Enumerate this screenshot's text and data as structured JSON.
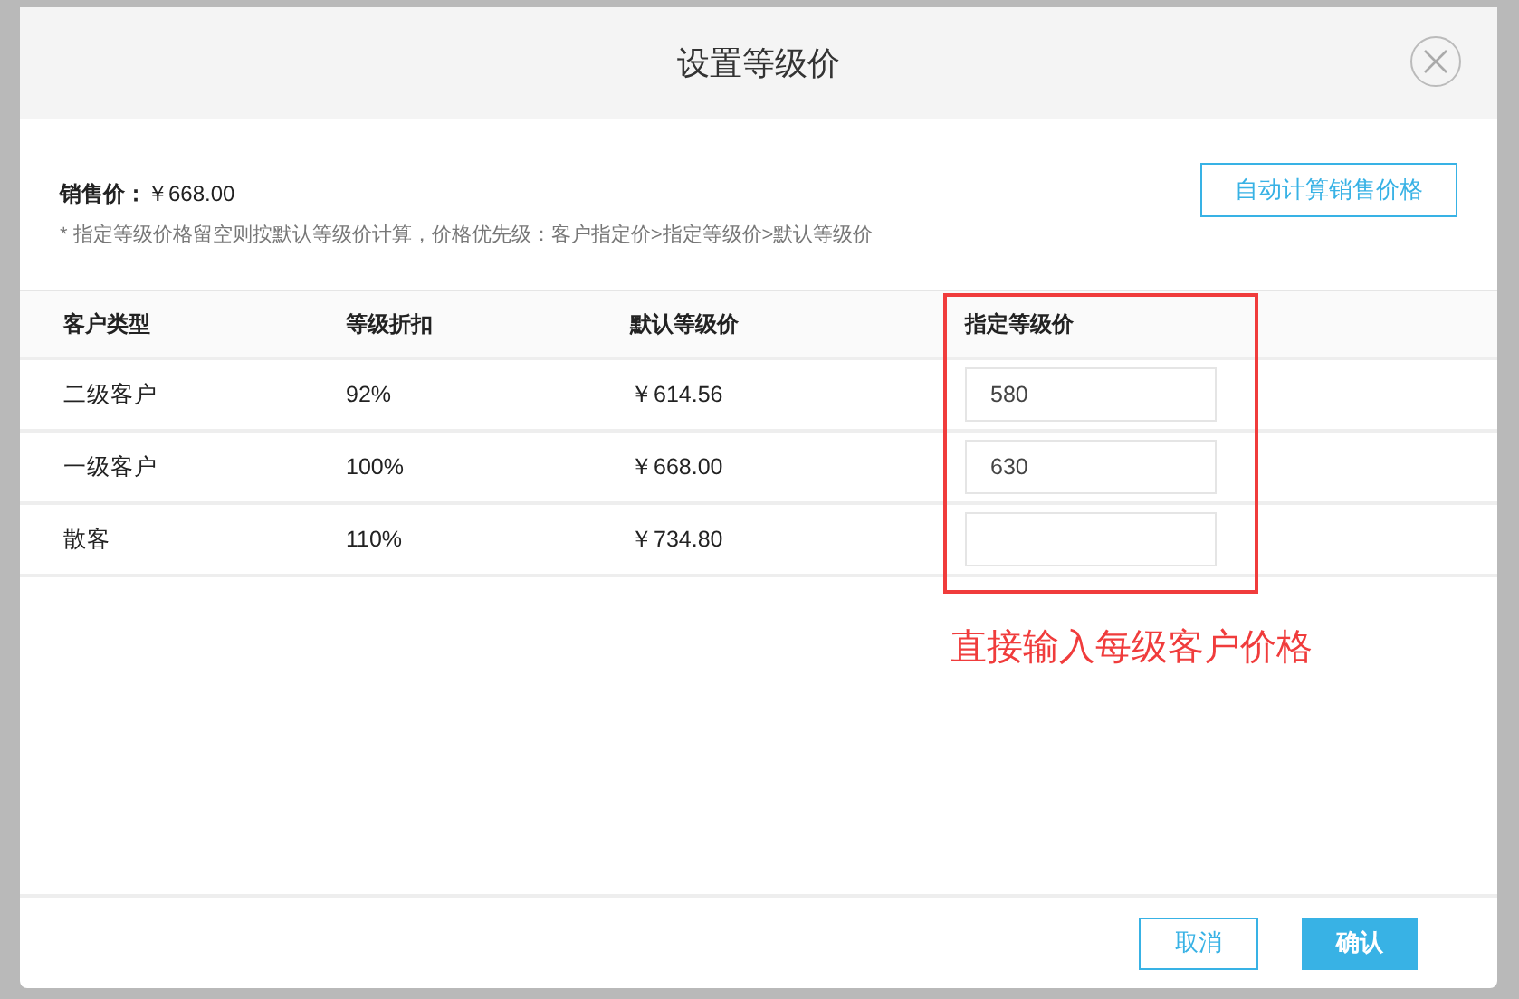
{
  "dialog": {
    "title": "设置等级价",
    "sale_price": {
      "label": "销售价：",
      "value": "￥668.00"
    },
    "note": "* 指定等级价格留空则按默认等级价计算，价格优先级：客户指定价>指定等级价>默认等级价",
    "auto_button": "自动计算销售价格",
    "table": {
      "columns": [
        "客户类型",
        "等级折扣",
        "默认等级价",
        "指定等级价"
      ],
      "rows": [
        {
          "type": "二级客户",
          "discount": "92%",
          "default_price": "￥614.56",
          "custom_price": "580"
        },
        {
          "type": "一级客户",
          "discount": "100%",
          "default_price": "￥668.00",
          "custom_price": "630"
        },
        {
          "type": "散客",
          "discount": "110%",
          "default_price": "￥734.80",
          "custom_price": ""
        }
      ]
    },
    "annotation": "直接输入每级客户价格",
    "buttons": [
      {
        "label": "取消",
        "kind": "secondary"
      },
      {
        "label": "确认",
        "kind": "primary"
      }
    ]
  }
}
